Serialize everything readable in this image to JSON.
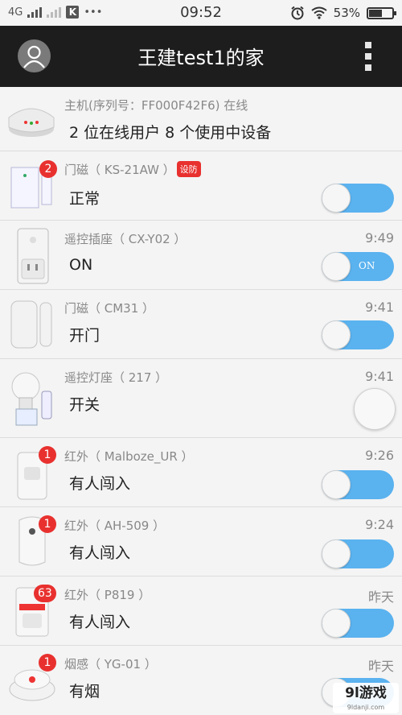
{
  "status_bar": {
    "network": "4G",
    "clock": "09:52",
    "battery": "53%"
  },
  "app_bar": {
    "title": "王建test1的家"
  },
  "hub": {
    "meta": "主机(序列号：FF000F42F6) 在线",
    "summary": "2 位在线用户  8 个使用中设备"
  },
  "devices": [
    {
      "name": "门磁（ KS-21AW ）",
      "badge": "2",
      "tag": "设防",
      "status": "正常",
      "time": "",
      "control": "toggle"
    },
    {
      "name": "遥控插座（ CX-Y02 ）",
      "badge": "",
      "tag": "",
      "status": "ON",
      "time": "9:49",
      "control": "toggle",
      "toggle_text": "ON"
    },
    {
      "name": "门磁（ CM31 ）",
      "badge": "",
      "tag": "",
      "status": "开门",
      "time": "9:41",
      "control": "toggle"
    },
    {
      "name": "遥控灯座（ 217 ）",
      "badge": "",
      "tag": "",
      "status": "开关",
      "time": "9:41",
      "control": "button"
    },
    {
      "name": "红外（ Malboze_UR ）",
      "badge": "1",
      "tag": "",
      "status": "有人闯入",
      "time": "9:26",
      "control": "toggle"
    },
    {
      "name": "红外（ AH-509 ）",
      "badge": "1",
      "tag": "",
      "status": "有人闯入",
      "time": "9:24",
      "control": "toggle"
    },
    {
      "name": "红外（ P819 ）",
      "badge": "63",
      "tag": "",
      "status": "有人闯入",
      "time": "昨天",
      "control": "toggle"
    },
    {
      "name": "烟感（ YG-01 ）",
      "badge": "1",
      "tag": "",
      "status": "有烟",
      "time": "昨天",
      "control": "toggle"
    }
  ],
  "watermark": {
    "logo": "9l游戏",
    "url": "9ldanji.com"
  },
  "colors": {
    "app_bar": "#1d1d1d",
    "toggle_on": "#5ab2ef",
    "badge": "#e8312f"
  }
}
